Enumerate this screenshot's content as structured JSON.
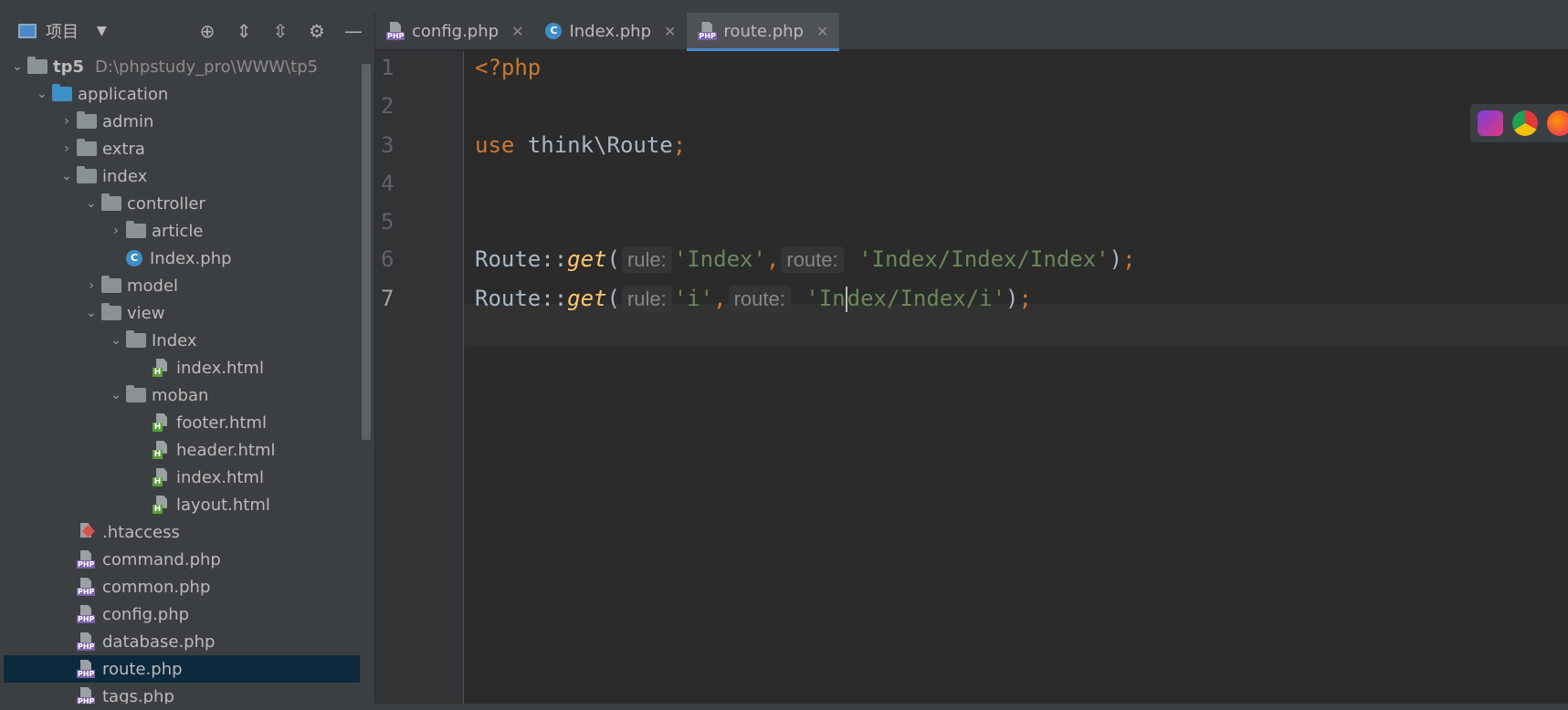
{
  "project_panel": {
    "title": "项目",
    "root_name": "tp5",
    "root_path": "D:\\phpstudy_pro\\WWW\\tp5",
    "tree": [
      {
        "label": "application",
        "indent": 1,
        "type": "folder-blue",
        "arrow": "down"
      },
      {
        "label": "admin",
        "indent": 2,
        "type": "folder",
        "arrow": "right"
      },
      {
        "label": "extra",
        "indent": 2,
        "type": "folder",
        "arrow": "right"
      },
      {
        "label": "index",
        "indent": 2,
        "type": "folder",
        "arrow": "down"
      },
      {
        "label": "controller",
        "indent": 3,
        "type": "folder",
        "arrow": "down"
      },
      {
        "label": "article",
        "indent": 4,
        "type": "folder",
        "arrow": "right"
      },
      {
        "label": "Index.php",
        "indent": 4,
        "type": "class",
        "arrow": ""
      },
      {
        "label": "model",
        "indent": 3,
        "type": "folder",
        "arrow": "right"
      },
      {
        "label": "view",
        "indent": 3,
        "type": "folder",
        "arrow": "down"
      },
      {
        "label": "Index",
        "indent": 4,
        "type": "folder",
        "arrow": "down"
      },
      {
        "label": "index.html",
        "indent": 5,
        "type": "html",
        "arrow": ""
      },
      {
        "label": "moban",
        "indent": 4,
        "type": "folder",
        "arrow": "down"
      },
      {
        "label": "footer.html",
        "indent": 5,
        "type": "html",
        "arrow": ""
      },
      {
        "label": "header.html",
        "indent": 5,
        "type": "html",
        "arrow": ""
      },
      {
        "label": "index.html",
        "indent": 5,
        "type": "html",
        "arrow": ""
      },
      {
        "label": "layout.html",
        "indent": 5,
        "type": "html",
        "arrow": ""
      },
      {
        "label": ".htaccess",
        "indent": 2,
        "type": "htaccess",
        "arrow": ""
      },
      {
        "label": "command.php",
        "indent": 2,
        "type": "php",
        "arrow": ""
      },
      {
        "label": "common.php",
        "indent": 2,
        "type": "php",
        "arrow": ""
      },
      {
        "label": "config.php",
        "indent": 2,
        "type": "php",
        "arrow": ""
      },
      {
        "label": "database.php",
        "indent": 2,
        "type": "php",
        "arrow": ""
      },
      {
        "label": "route.php",
        "indent": 2,
        "type": "php",
        "arrow": "",
        "selected": true
      },
      {
        "label": "tags.php",
        "indent": 2,
        "type": "php",
        "arrow": ""
      }
    ]
  },
  "tabs": [
    {
      "label": "config.php",
      "icon": "php"
    },
    {
      "label": "Index.php",
      "icon": "class"
    },
    {
      "label": "route.php",
      "icon": "php",
      "active": true
    }
  ],
  "editor": {
    "line_numbers": [
      "1",
      "2",
      "3",
      "4",
      "5",
      "6",
      "7"
    ],
    "current_line": 7,
    "lines": {
      "l1_tag": "<?php",
      "l3_use": "use",
      "l3_ns": " think\\Route",
      "l3_semi": ";",
      "l6_cls": "Route::",
      "l6_fn": "get",
      "l6_paren": "(",
      "l6_hint_rule": "rule:",
      "l6_arg1": "'Index'",
      "l6_comma": ",",
      "l6_hint_route": "route:",
      "l6_arg2": "'Index/Index/Index'",
      "l6_close": ")",
      "l6_semi": ";",
      "l7_cls": "Route::",
      "l7_fn": "get",
      "l7_paren": "(",
      "l7_hint_rule": "rule:",
      "l7_arg1": "'i'",
      "l7_comma": ",",
      "l7_hint_route": "route:",
      "l7_arg2a": "'In",
      "l7_arg2b": "dex/Index/i'",
      "l7_close": ")",
      "l7_semi": ";"
    }
  },
  "colors": {
    "keyword": "#cc7832",
    "function": "#ffc66d",
    "string": "#6a8759",
    "selection": "#0d293e",
    "accent": "#4a88c7"
  }
}
